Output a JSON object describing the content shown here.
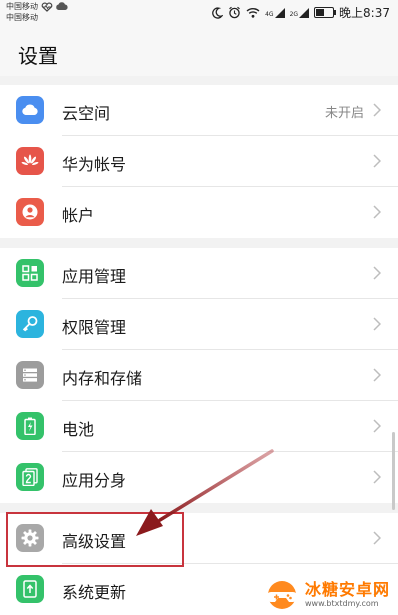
{
  "status_bar": {
    "carrier_1": "中国移动",
    "carrier_2": "中国移动",
    "network_4g": "4G",
    "network_2g": "2G",
    "battery_level": 0.55,
    "time": "晚上8:37"
  },
  "header": {
    "title": "设置"
  },
  "groups": [
    {
      "items": [
        {
          "label": "云空间",
          "value": "未开启",
          "icon": "cloud-icon",
          "color": "#4a8ef0"
        },
        {
          "label": "华为帐号",
          "value": "",
          "icon": "huawei-logo-icon",
          "color": "#e6554a"
        },
        {
          "label": "帐户",
          "value": "",
          "icon": "person-icon",
          "color": "#ea5c4a"
        }
      ]
    },
    {
      "items": [
        {
          "label": "应用管理",
          "value": "",
          "icon": "apps-grid-icon",
          "color": "#34c26a"
        },
        {
          "label": "权限管理",
          "value": "",
          "icon": "key-icon",
          "color": "#2cb4de"
        },
        {
          "label": "内存和存储",
          "value": "",
          "icon": "storage-icon",
          "color": "#9c9c9c"
        },
        {
          "label": "电池",
          "value": "",
          "icon": "battery-icon",
          "color": "#34c26a"
        },
        {
          "label": "应用分身",
          "value": "",
          "icon": "app-twin-icon",
          "color": "#34c26a"
        }
      ]
    },
    {
      "items": [
        {
          "label": "高级设置",
          "value": "",
          "icon": "gear-icon",
          "color": "#a8a8a8"
        },
        {
          "label": "系统更新",
          "value": "",
          "icon": "system-update-icon",
          "color": "#34c26a"
        }
      ]
    }
  ],
  "watermark": {
    "title": "冰糖安卓网",
    "url": "www.btxtdmy.com"
  },
  "colors": {
    "highlight": "#c8343d",
    "arrow": "#8b1a1d"
  }
}
